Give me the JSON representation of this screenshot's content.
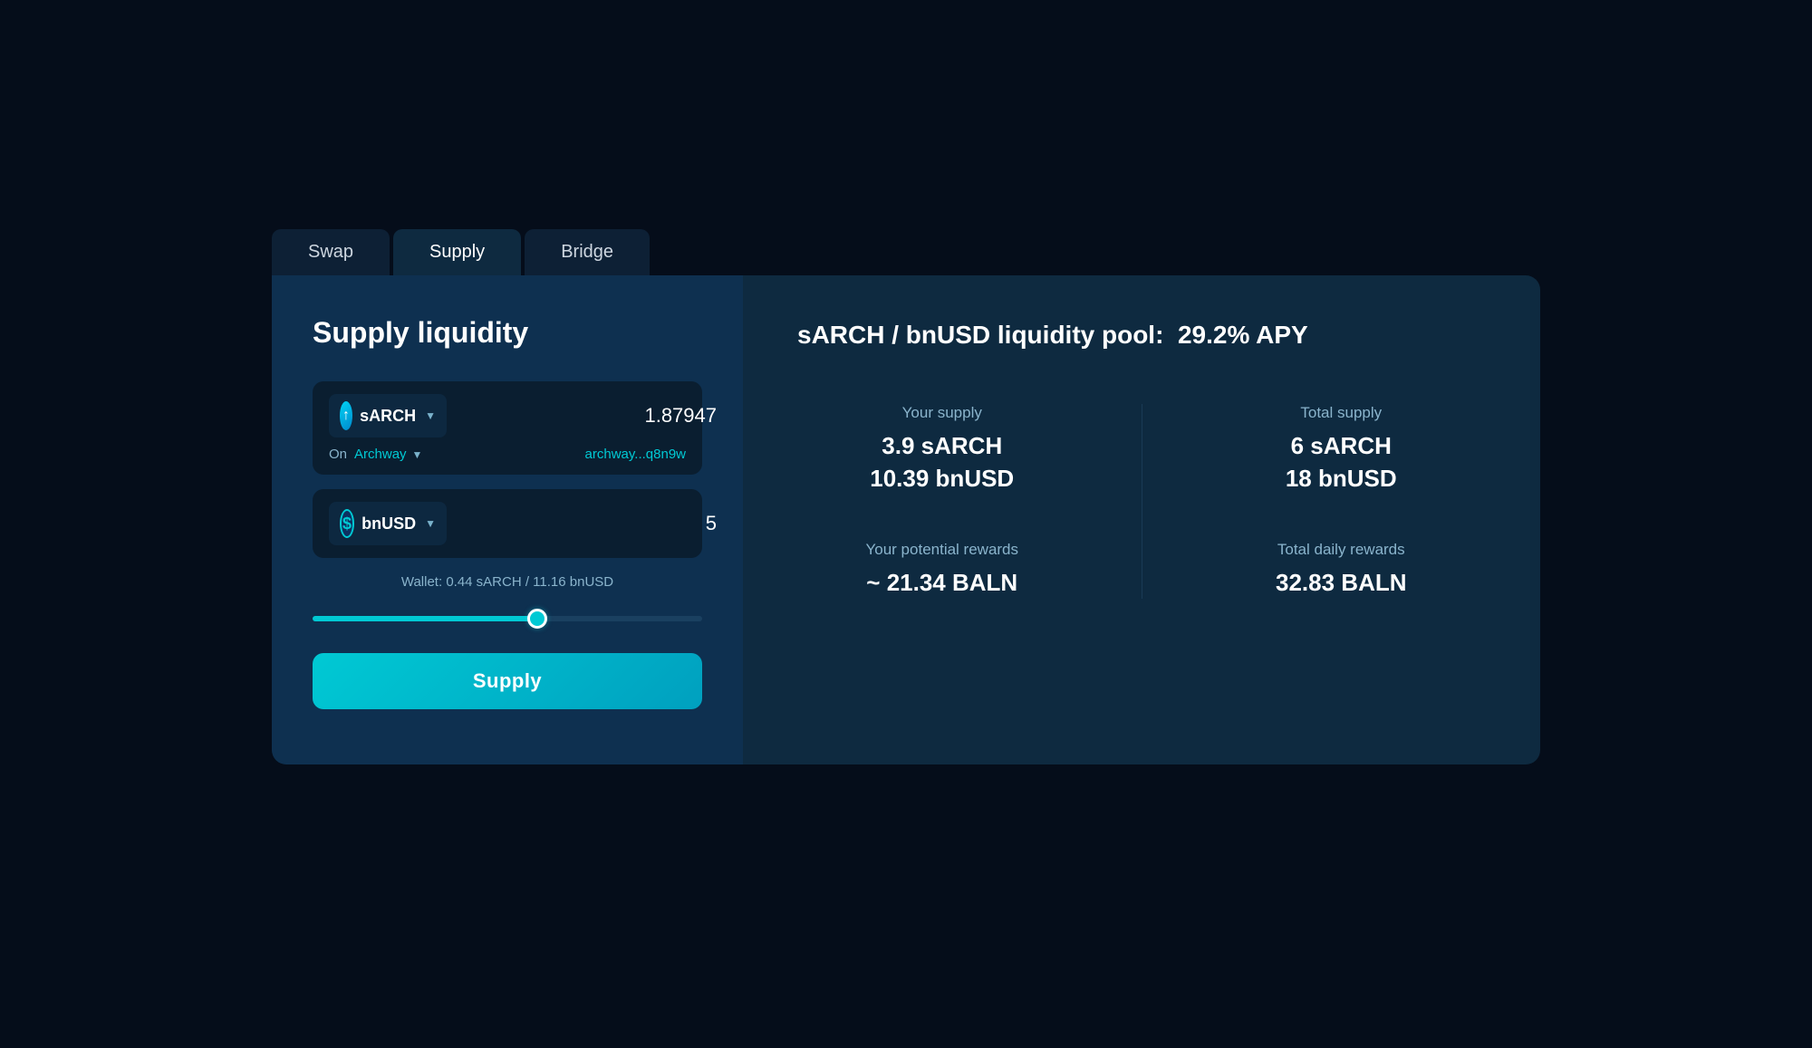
{
  "tabs": [
    {
      "id": "swap",
      "label": "Swap",
      "active": false
    },
    {
      "id": "supply",
      "label": "Supply",
      "active": true
    },
    {
      "id": "bridge",
      "label": "Bridge",
      "active": false
    }
  ],
  "supply_form": {
    "title": "Supply liquidity",
    "sarch_token": "sARCH",
    "sarch_amount": "1.87947",
    "on_label": "On",
    "network": "Archway",
    "wallet_address": "archway...q8n9w",
    "bnusd_token": "bnUSD",
    "bnusd_amount": "5",
    "wallet_balance": "Wallet: 0.44 sARCH / 11.16 bnUSD",
    "slider_value": 58,
    "supply_button": "Supply"
  },
  "pool_info": {
    "title_prefix": "sARCH / bnUSD liquidity pool:",
    "apy": "29.2% APY",
    "your_supply_label": "Your supply",
    "your_supply_sarch": "3.9 sARCH",
    "your_supply_bnusd": "10.39 bnUSD",
    "total_supply_label": "Total supply",
    "total_supply_sarch": "6 sARCH",
    "total_supply_bnusd": "18 bnUSD",
    "your_rewards_label": "Your potential rewards",
    "your_rewards_value": "~ 21.34 BALN",
    "total_rewards_label": "Total daily rewards",
    "total_rewards_value": "32.83 BALN"
  },
  "colors": {
    "accent": "#00c9d4",
    "bg_dark": "#050d1a",
    "bg_panel": "#0e2a40",
    "bg_form": "#0e3050"
  }
}
